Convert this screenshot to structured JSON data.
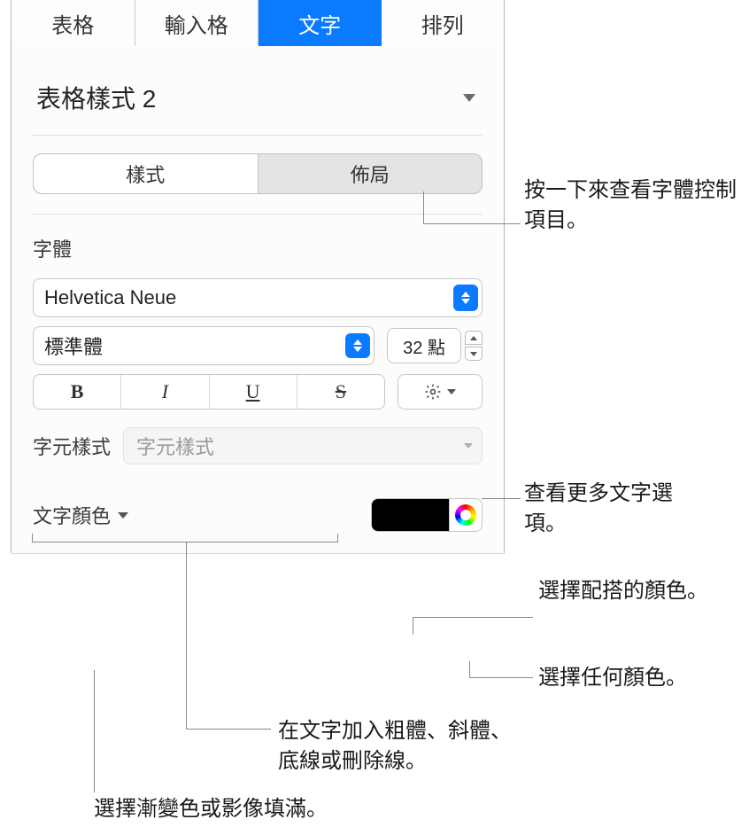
{
  "tabs": {
    "table": "表格",
    "cell": "輸入格",
    "text": "文字",
    "arrange": "排列"
  },
  "style_name": "表格樣式 2",
  "seg": {
    "style": "樣式",
    "layout": "佈局"
  },
  "font": {
    "section": "字體",
    "family": "Helvetica Neue",
    "weight": "標準體",
    "size": "32 點",
    "bold": "B",
    "italic": "I",
    "underline": "U",
    "strike": "S"
  },
  "char_style": {
    "label": "字元樣式",
    "placeholder": "字元樣式"
  },
  "text_color": {
    "label": "文字顏色"
  },
  "callouts": {
    "seg": "按一下來查看字體控制項目。",
    "gear": "查看更多文字選項。",
    "swatch": "選擇配搭的顏色。",
    "wheel": "選擇任何顏色。",
    "bius": "在文字加入粗體、斜體、底線或刪除線。",
    "textcolor": "選擇漸變色或影像填滿。"
  }
}
